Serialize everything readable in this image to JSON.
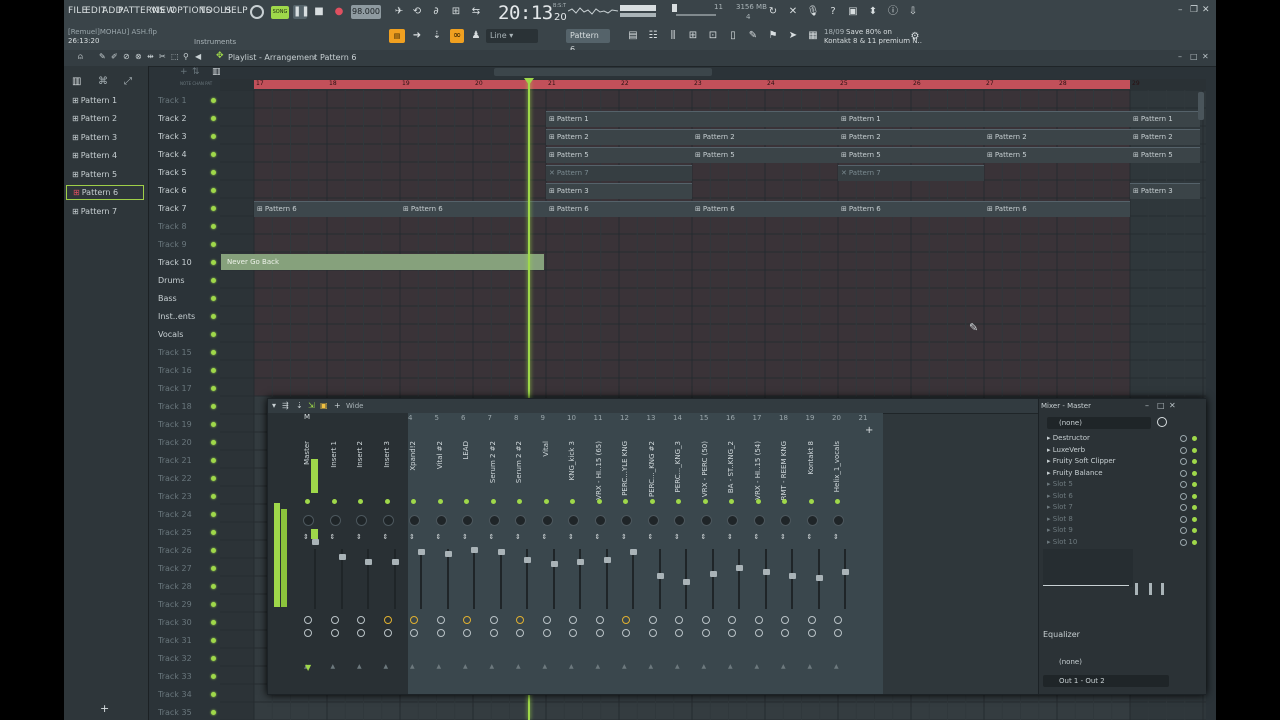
{
  "menu": [
    "FILE",
    "EDIT",
    "ADD",
    "PATTERNS",
    "VIEW",
    "OPTIONS",
    "TOOLS",
    "HELP"
  ],
  "transport": {
    "song_label": "SONG",
    "tempo": "98.000",
    "time": "20:13",
    "time_frac": "20",
    "time_label": "B:S:T",
    "cpu_value": "11",
    "memory": "3156 MB",
    "voices": "4"
  },
  "project": {
    "user_file": "[Remuel]MOHAU] ASH.flp",
    "elapsed": "26:13:20",
    "instruments_label": "Instruments"
  },
  "snap": {
    "mode": "Line",
    "pattern_selector": "Pattern 6"
  },
  "news": {
    "date": "18/09",
    "line1": "Save 80% on",
    "line2": "Kontakt 8 & 11 premium N.."
  },
  "playlist": {
    "breadcrumb": "Playlist - Arrangement",
    "breadcrumb_sep": "›",
    "current_pattern": "Pattern 6",
    "patterns": [
      "Pattern 1",
      "Pattern 2",
      "Pattern 3",
      "Pattern 4",
      "Pattern 5",
      "Pattern 6",
      "Pattern 7"
    ],
    "selected_pattern": "Pattern 6",
    "tracks": [
      {
        "label": "Track 1",
        "dim": true
      },
      {
        "label": "Track 2"
      },
      {
        "label": "Track 3"
      },
      {
        "label": "Track 4"
      },
      {
        "label": "Track 5"
      },
      {
        "label": "Track 6"
      },
      {
        "label": "Track 7"
      },
      {
        "label": "Track 8",
        "dim": true
      },
      {
        "label": "Track 9",
        "dim": true
      },
      {
        "label": "Track 10"
      },
      {
        "label": "Drums"
      },
      {
        "label": "Bass"
      },
      {
        "label": "Inst..ents"
      },
      {
        "label": "Vocals"
      },
      {
        "label": "Track 15",
        "dim": true
      },
      {
        "label": "Track 16",
        "dim": true
      },
      {
        "label": "Track 17",
        "dim": true
      },
      {
        "label": "Track 18",
        "dim": true
      },
      {
        "label": "Track 19",
        "dim": true
      },
      {
        "label": "Track 20",
        "dim": true
      },
      {
        "label": "Track 21",
        "dim": true
      },
      {
        "label": "Track 22",
        "dim": true
      },
      {
        "label": "Track 23",
        "dim": true
      },
      {
        "label": "Track 24",
        "dim": true
      },
      {
        "label": "Track 25",
        "dim": true
      },
      {
        "label": "Track 26",
        "dim": true
      },
      {
        "label": "Track 27",
        "dim": true
      },
      {
        "label": "Track 28",
        "dim": true
      },
      {
        "label": "Track 29",
        "dim": true
      },
      {
        "label": "Track 30",
        "dim": true
      },
      {
        "label": "Track 31",
        "dim": true
      },
      {
        "label": "Track 32",
        "dim": true
      },
      {
        "label": "Track 33",
        "dim": true
      },
      {
        "label": "Track 34",
        "dim": true
      },
      {
        "label": "Track 35",
        "dim": true
      }
    ],
    "bars": [
      "17",
      "18",
      "19",
      "20",
      "21",
      "22",
      "23",
      "24",
      "25",
      "26",
      "27",
      "28",
      "29"
    ],
    "audio_clip": "Never Go Back"
  },
  "mixer": {
    "title": "Mixer - Master",
    "view_mode": "Wide",
    "master_label": "M",
    "strips": [
      "Master",
      "Insert 1",
      "Insert 2",
      "Insert 3",
      "Xpand!2",
      "Vital #2",
      "LEAD",
      "Serum 2 #2",
      "Serum 2 #2",
      "Vital",
      "KNG_kick 3",
      "VRX - HI..15 (65)",
      "PERC...YLE KNG",
      "PERC..._KNG #2",
      "PERC..._KNG_3",
      "VRX - PERC (50)",
      "BA - ST..KNG_2",
      "VRX - HI..15 (54)",
      "RMT - REEM KNG",
      "Kontakt 8",
      "Helix_1_vocals"
    ],
    "strip_numbers": [
      "",
      "",
      "",
      "",
      "4",
      "5",
      "6",
      "7",
      "8",
      "9",
      "10",
      "11",
      "12",
      "13",
      "14",
      "15",
      "16",
      "17",
      "18",
      "19",
      "20",
      "21"
    ],
    "inspector": {
      "preset": "(none)",
      "slots": [
        "Destructor",
        "LuxeVerb",
        "Fruity Soft Clipper",
        "Fruity Balance",
        "Slot 5",
        "Slot 6",
        "Slot 7",
        "Slot 8",
        "Slot 9",
        "Slot 10"
      ],
      "eq_label": "Equalizer",
      "bottom_preset": "(none)",
      "output": "Out 1 - Out 2"
    }
  },
  "colors": {
    "accent": "#9fd84a",
    "loop": "#c2505a",
    "audio": "#86a17c"
  }
}
